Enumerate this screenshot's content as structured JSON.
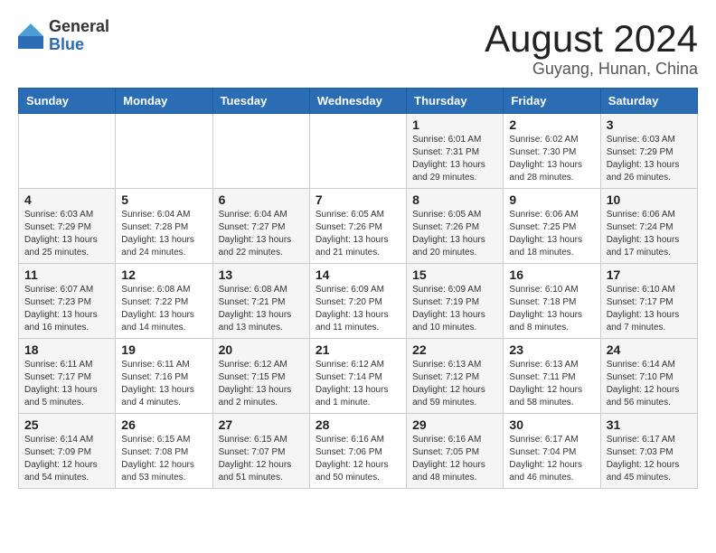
{
  "logo": {
    "general": "General",
    "blue": "Blue"
  },
  "header": {
    "title": "August 2024",
    "subtitle": "Guyang, Hunan, China"
  },
  "weekdays": [
    "Sunday",
    "Monday",
    "Tuesday",
    "Wednesday",
    "Thursday",
    "Friday",
    "Saturday"
  ],
  "weeks": [
    [
      {
        "day": "",
        "sunrise": "",
        "sunset": "",
        "daylight": ""
      },
      {
        "day": "",
        "sunrise": "",
        "sunset": "",
        "daylight": ""
      },
      {
        "day": "",
        "sunrise": "",
        "sunset": "",
        "daylight": ""
      },
      {
        "day": "",
        "sunrise": "",
        "sunset": "",
        "daylight": ""
      },
      {
        "day": "1",
        "sunrise": "Sunrise: 6:01 AM",
        "sunset": "Sunset: 7:31 PM",
        "daylight": "Daylight: 13 hours and 29 minutes."
      },
      {
        "day": "2",
        "sunrise": "Sunrise: 6:02 AM",
        "sunset": "Sunset: 7:30 PM",
        "daylight": "Daylight: 13 hours and 28 minutes."
      },
      {
        "day": "3",
        "sunrise": "Sunrise: 6:03 AM",
        "sunset": "Sunset: 7:29 PM",
        "daylight": "Daylight: 13 hours and 26 minutes."
      }
    ],
    [
      {
        "day": "4",
        "sunrise": "Sunrise: 6:03 AM",
        "sunset": "Sunset: 7:29 PM",
        "daylight": "Daylight: 13 hours and 25 minutes."
      },
      {
        "day": "5",
        "sunrise": "Sunrise: 6:04 AM",
        "sunset": "Sunset: 7:28 PM",
        "daylight": "Daylight: 13 hours and 24 minutes."
      },
      {
        "day": "6",
        "sunrise": "Sunrise: 6:04 AM",
        "sunset": "Sunset: 7:27 PM",
        "daylight": "Daylight: 13 hours and 22 minutes."
      },
      {
        "day": "7",
        "sunrise": "Sunrise: 6:05 AM",
        "sunset": "Sunset: 7:26 PM",
        "daylight": "Daylight: 13 hours and 21 minutes."
      },
      {
        "day": "8",
        "sunrise": "Sunrise: 6:05 AM",
        "sunset": "Sunset: 7:26 PM",
        "daylight": "Daylight: 13 hours and 20 minutes."
      },
      {
        "day": "9",
        "sunrise": "Sunrise: 6:06 AM",
        "sunset": "Sunset: 7:25 PM",
        "daylight": "Daylight: 13 hours and 18 minutes."
      },
      {
        "day": "10",
        "sunrise": "Sunrise: 6:06 AM",
        "sunset": "Sunset: 7:24 PM",
        "daylight": "Daylight: 13 hours and 17 minutes."
      }
    ],
    [
      {
        "day": "11",
        "sunrise": "Sunrise: 6:07 AM",
        "sunset": "Sunset: 7:23 PM",
        "daylight": "Daylight: 13 hours and 16 minutes."
      },
      {
        "day": "12",
        "sunrise": "Sunrise: 6:08 AM",
        "sunset": "Sunset: 7:22 PM",
        "daylight": "Daylight: 13 hours and 14 minutes."
      },
      {
        "day": "13",
        "sunrise": "Sunrise: 6:08 AM",
        "sunset": "Sunset: 7:21 PM",
        "daylight": "Daylight: 13 hours and 13 minutes."
      },
      {
        "day": "14",
        "sunrise": "Sunrise: 6:09 AM",
        "sunset": "Sunset: 7:20 PM",
        "daylight": "Daylight: 13 hours and 11 minutes."
      },
      {
        "day": "15",
        "sunrise": "Sunrise: 6:09 AM",
        "sunset": "Sunset: 7:19 PM",
        "daylight": "Daylight: 13 hours and 10 minutes."
      },
      {
        "day": "16",
        "sunrise": "Sunrise: 6:10 AM",
        "sunset": "Sunset: 7:18 PM",
        "daylight": "Daylight: 13 hours and 8 minutes."
      },
      {
        "day": "17",
        "sunrise": "Sunrise: 6:10 AM",
        "sunset": "Sunset: 7:17 PM",
        "daylight": "Daylight: 13 hours and 7 minutes."
      }
    ],
    [
      {
        "day": "18",
        "sunrise": "Sunrise: 6:11 AM",
        "sunset": "Sunset: 7:17 PM",
        "daylight": "Daylight: 13 hours and 5 minutes."
      },
      {
        "day": "19",
        "sunrise": "Sunrise: 6:11 AM",
        "sunset": "Sunset: 7:16 PM",
        "daylight": "Daylight: 13 hours and 4 minutes."
      },
      {
        "day": "20",
        "sunrise": "Sunrise: 6:12 AM",
        "sunset": "Sunset: 7:15 PM",
        "daylight": "Daylight: 13 hours and 2 minutes."
      },
      {
        "day": "21",
        "sunrise": "Sunrise: 6:12 AM",
        "sunset": "Sunset: 7:14 PM",
        "daylight": "Daylight: 13 hours and 1 minute."
      },
      {
        "day": "22",
        "sunrise": "Sunrise: 6:13 AM",
        "sunset": "Sunset: 7:12 PM",
        "daylight": "Daylight: 12 hours and 59 minutes."
      },
      {
        "day": "23",
        "sunrise": "Sunrise: 6:13 AM",
        "sunset": "Sunset: 7:11 PM",
        "daylight": "Daylight: 12 hours and 58 minutes."
      },
      {
        "day": "24",
        "sunrise": "Sunrise: 6:14 AM",
        "sunset": "Sunset: 7:10 PM",
        "daylight": "Daylight: 12 hours and 56 minutes."
      }
    ],
    [
      {
        "day": "25",
        "sunrise": "Sunrise: 6:14 AM",
        "sunset": "Sunset: 7:09 PM",
        "daylight": "Daylight: 12 hours and 54 minutes."
      },
      {
        "day": "26",
        "sunrise": "Sunrise: 6:15 AM",
        "sunset": "Sunset: 7:08 PM",
        "daylight": "Daylight: 12 hours and 53 minutes."
      },
      {
        "day": "27",
        "sunrise": "Sunrise: 6:15 AM",
        "sunset": "Sunset: 7:07 PM",
        "daylight": "Daylight: 12 hours and 51 minutes."
      },
      {
        "day": "28",
        "sunrise": "Sunrise: 6:16 AM",
        "sunset": "Sunset: 7:06 PM",
        "daylight": "Daylight: 12 hours and 50 minutes."
      },
      {
        "day": "29",
        "sunrise": "Sunrise: 6:16 AM",
        "sunset": "Sunset: 7:05 PM",
        "daylight": "Daylight: 12 hours and 48 minutes."
      },
      {
        "day": "30",
        "sunrise": "Sunrise: 6:17 AM",
        "sunset": "Sunset: 7:04 PM",
        "daylight": "Daylight: 12 hours and 46 minutes."
      },
      {
        "day": "31",
        "sunrise": "Sunrise: 6:17 AM",
        "sunset": "Sunset: 7:03 PM",
        "daylight": "Daylight: 12 hours and 45 minutes."
      }
    ]
  ]
}
